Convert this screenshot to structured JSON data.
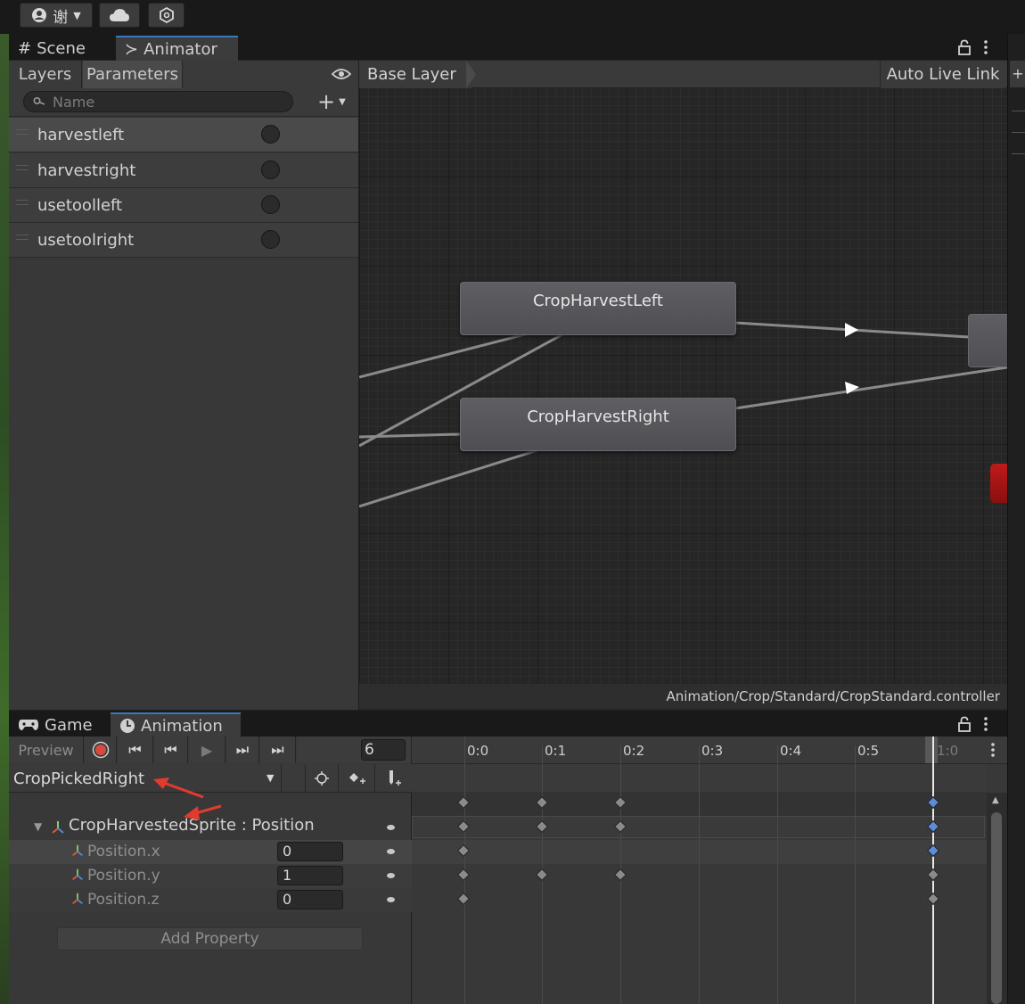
{
  "toolbar": {
    "account_label": "谢",
    "cloud_icon": "cloud-icon",
    "collab_icon": "collab-icon"
  },
  "animator_window": {
    "tabs": [
      {
        "icon": "#",
        "label": "Scene"
      },
      {
        "icon": "≻",
        "label": "Animator"
      }
    ],
    "subtabs": [
      "Layers",
      "Parameters"
    ],
    "search_placeholder": "Name",
    "parameters": [
      {
        "name": "harvestleft"
      },
      {
        "name": "harvestright"
      },
      {
        "name": "usetoolleft"
      },
      {
        "name": "usetoolright"
      }
    ],
    "breadcrumb": "Base Layer",
    "auto_live_link": "Auto Live Link",
    "states": [
      "CropHarvestLeft",
      "CropHarvestRight"
    ],
    "controller_path": "Animation/Crop/Standard/CropStandard.controller"
  },
  "animation_window": {
    "tabs": [
      {
        "label": "Game"
      },
      {
        "label": "Animation"
      }
    ],
    "preview_label": "Preview",
    "frame_value": "6",
    "timeline_ticks": [
      "0:0",
      "0:1",
      "0:2",
      "0:3",
      "0:4",
      "0:5",
      "1:0"
    ],
    "clip_name": "CropPickedRight",
    "object_label": "CropHarvestedSprite : Position",
    "properties": [
      {
        "name": "Position.x",
        "value": "0"
      },
      {
        "name": "Position.y",
        "value": "1"
      },
      {
        "name": "Position.z",
        "value": "0"
      }
    ],
    "add_property_label": "Add Property"
  },
  "colors": {
    "accent_red": "#e23b2e",
    "selected_key": "#5c8dd6",
    "tab_accent": "#3a79bb"
  }
}
